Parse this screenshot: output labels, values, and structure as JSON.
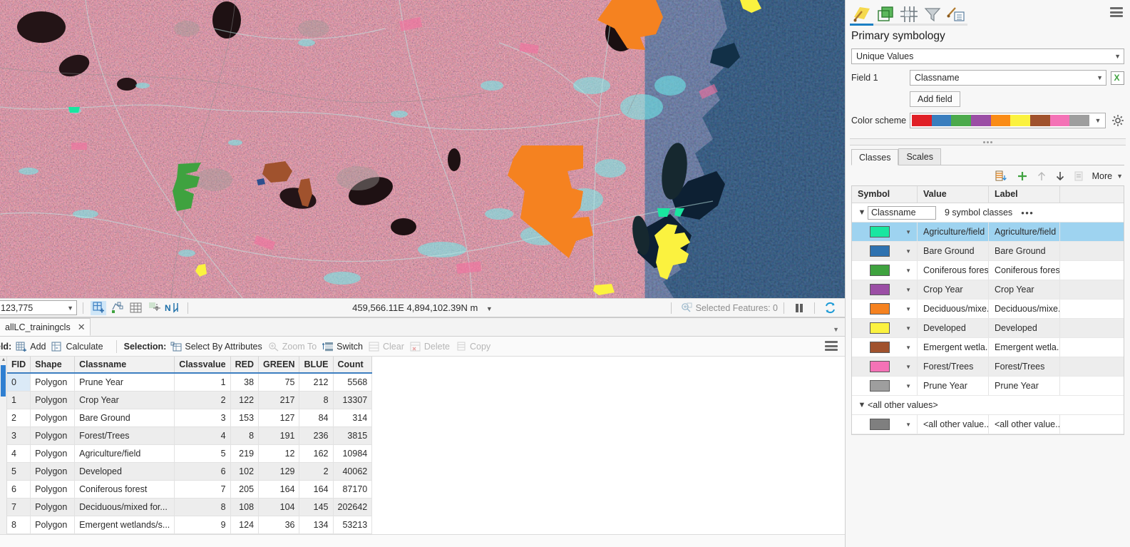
{
  "map": {
    "statusbar": {
      "scale": "123,775",
      "coordinates": "459,566.11E 4,894,102.39N m",
      "selected_features": "Selected Features: 0",
      "tools": [
        "add-data-icon",
        "select-features-icon",
        "table-grid-icon",
        "explore-icon",
        "north-arrow-icon"
      ]
    }
  },
  "attribute_table": {
    "tab_label": "allLC_trainingcls",
    "toolbar": {
      "field_label": "eld:",
      "add_label": "Add",
      "calculate_label": "Calculate",
      "selection_label": "Selection:",
      "select_by_attributes_label": "Select By Attributes",
      "zoom_to_label": "Zoom To",
      "switch_label": "Switch",
      "clear_label": "Clear",
      "delete_label": "Delete",
      "copy_label": "Copy"
    },
    "columns": [
      "FID",
      "Shape",
      "Classname",
      "Classvalue",
      "RED",
      "GREEN",
      "BLUE",
      "Count"
    ],
    "rows": [
      {
        "FID": "0",
        "Shape": "Polygon",
        "Classname": "Prune Year",
        "Classvalue": "1",
        "RED": "38",
        "GREEN": "75",
        "BLUE": "212",
        "Count": "5568"
      },
      {
        "FID": "1",
        "Shape": "Polygon",
        "Classname": "Crop Year",
        "Classvalue": "2",
        "RED": "122",
        "GREEN": "217",
        "BLUE": "8",
        "Count": "13307"
      },
      {
        "FID": "2",
        "Shape": "Polygon",
        "Classname": "Bare Ground",
        "Classvalue": "3",
        "RED": "153",
        "GREEN": "127",
        "BLUE": "84",
        "Count": "314"
      },
      {
        "FID": "3",
        "Shape": "Polygon",
        "Classname": "Forest/Trees",
        "Classvalue": "4",
        "RED": "8",
        "GREEN": "191",
        "BLUE": "236",
        "Count": "3815"
      },
      {
        "FID": "4",
        "Shape": "Polygon",
        "Classname": "Agriculture/field",
        "Classvalue": "5",
        "RED": "219",
        "GREEN": "12",
        "BLUE": "162",
        "Count": "10984"
      },
      {
        "FID": "5",
        "Shape": "Polygon",
        "Classname": "Developed",
        "Classvalue": "6",
        "RED": "102",
        "GREEN": "129",
        "BLUE": "2",
        "Count": "40062"
      },
      {
        "FID": "6",
        "Shape": "Polygon",
        "Classname": "Coniferous forest",
        "Classvalue": "7",
        "RED": "205",
        "GREEN": "164",
        "BLUE": "164",
        "Count": "87170"
      },
      {
        "FID": "7",
        "Shape": "Polygon",
        "Classname": "Deciduous/mixed for...",
        "Classvalue": "8",
        "RED": "108",
        "GREEN": "104",
        "BLUE": "145",
        "Count": "202642"
      },
      {
        "FID": "8",
        "Shape": "Polygon",
        "Classname": "Emergent wetlands/s...",
        "Classvalue": "9",
        "RED": "124",
        "GREEN": "36",
        "BLUE": "134",
        "Count": "53213"
      }
    ]
  },
  "symbology_panel": {
    "tabs": [
      "symbology-brush-icon",
      "vector-layer-icon",
      "raster-grid-icon",
      "filter-funnel-icon",
      "legend-brush-icon"
    ],
    "title": "Primary symbology",
    "primary_symbology_value": "Unique Values",
    "field1_label": "Field 1",
    "field1_value": "Classname",
    "add_field_label": "Add field",
    "expression_icon": "expression-x-icon",
    "color_scheme_label": "Color scheme",
    "color_scheme_colors": [
      "#e01f26",
      "#3a7ebe",
      "#4caa4c",
      "#9b4ea5",
      "#fa8c16",
      "#fbf23f",
      "#a0522d",
      "#f472b6",
      "#9e9e9e"
    ],
    "color_scheme_options_icon": "gear-icon",
    "classes_tab_label": "Classes",
    "scales_tab_label": "Scales",
    "actions": {
      "import_label": "import-classes-icon",
      "add_label": "add-class-icon",
      "move_up_label": "move-up-icon",
      "move_down_label": "move-down-icon",
      "reverse_label": "reverse-icon",
      "more_label": "More"
    },
    "table_headers": [
      "Symbol",
      "Value",
      "Label",
      ""
    ],
    "group": {
      "field_name": "Classname",
      "summary": "9 symbol classes",
      "menu": "•••"
    },
    "classes": [
      {
        "color": "#19e6a0",
        "value": "Agriculture/field",
        "label": "Agriculture/field",
        "selected": true
      },
      {
        "color": "#2e72b0",
        "value": "Bare Ground",
        "label": "Bare Ground",
        "selected": false
      },
      {
        "color": "#3fa23f",
        "value": "Coniferous forest",
        "label": "Coniferous forest",
        "selected": false
      },
      {
        "color": "#9b4ea5",
        "value": "Crop Year",
        "label": "Crop Year",
        "selected": false
      },
      {
        "color": "#f58220",
        "value": "Deciduous/mixe...",
        "label": "Deciduous/mixe...",
        "selected": false
      },
      {
        "color": "#fbf23f",
        "value": "Developed",
        "label": "Developed",
        "selected": false
      },
      {
        "color": "#a0522d",
        "value": "Emergent wetla...",
        "label": "Emergent wetla...",
        "selected": false
      },
      {
        "color": "#f472b6",
        "value": "Forest/Trees",
        "label": "Forest/Trees",
        "selected": false
      },
      {
        "color": "#9e9e9e",
        "value": "Prune Year",
        "label": "Prune Year",
        "selected": false
      }
    ],
    "all_other_values_group": "<all other values>",
    "all_other_values_row": {
      "color": "#7f7f7f",
      "value": "<all other value...",
      "label": "<all other value..."
    }
  }
}
